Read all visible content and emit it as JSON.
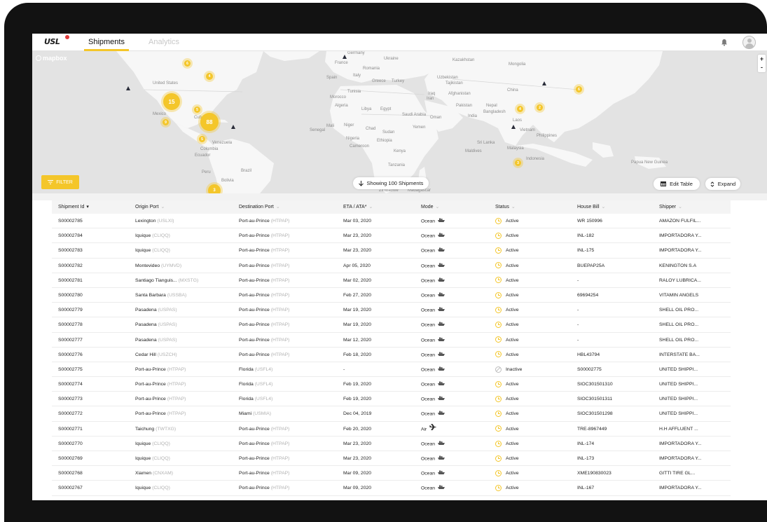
{
  "app": {
    "logo_text": "USL",
    "tabs": [
      {
        "label": "Shipments",
        "active": true
      },
      {
        "label": "Analytics",
        "active": false
      }
    ],
    "accent_color": "#f4c62a"
  },
  "map": {
    "attribution": "mapbox",
    "zoom_in": "+",
    "zoom_out": "-",
    "labels": [
      "Germany",
      "Ukraine",
      "France",
      "Romania",
      "Kazakhstan",
      "Mongolia",
      "Spain",
      "Italy",
      "Greece",
      "Turkey",
      "Uzbekistan",
      "Tajikistan",
      "United States",
      "China",
      "Tunisia",
      "Iraq",
      "Iran",
      "Afghanistan",
      "Morocco",
      "Algeria",
      "Libya",
      "Egypt",
      "Pakistan",
      "Nepal",
      "Saudi Arabia",
      "Bangladesh",
      "Mexico",
      "Cuba",
      "Oman",
      "India",
      "Laos",
      "Mali",
      "Niger",
      "Chad",
      "Sudan",
      "Yemen",
      "Vietnam",
      "Senegal",
      "Philippines",
      "Venezuela",
      "Nigeria",
      "Ethiopia",
      "Sri Lanka",
      "Colombia",
      "Cameroon",
      "Kenya",
      "Maldives",
      "Malaysia",
      "Ecuador",
      "Indonesia",
      "Tanzania",
      "Papua New Guinea",
      "Peru",
      "Brazil",
      "Zimbabwe",
      "Madagascar",
      "Bolivia"
    ],
    "clusters": [
      "15",
      "88",
      "6",
      "4",
      "5",
      "9",
      "5",
      "3",
      "4",
      "2",
      "6",
      "3"
    ],
    "filter_label": "FILTER",
    "showing_label": "Showing 100 Shipments",
    "edit_table_label": "Edit Table",
    "expand_label": "Expand"
  },
  "table": {
    "columns": [
      "Shipment Id",
      "Origin Port",
      "Destination Port",
      "ETA / ATA*",
      "Mode",
      "Status",
      "House Bill",
      "Shipper"
    ],
    "rows": [
      {
        "id": "S00002785",
        "origin": "Lexington",
        "origin_code": "(USLXI)",
        "dest": "Port-au-Prince",
        "dest_code": "(HTPAP)",
        "eta": "Mar 03, 2020",
        "mode": "Ocean",
        "status": "Active",
        "house_bill": "WR 150996",
        "shipper": "AMAZON FULFIL..."
      },
      {
        "id": "S00002784",
        "origin": "Iquique",
        "origin_code": "(CLIQQ)",
        "dest": "Port-au-Prince",
        "dest_code": "(HTPAP)",
        "eta": "Mar 23, 2020",
        "mode": "Ocean",
        "status": "Active",
        "house_bill": "INL-182",
        "shipper": "IMPORTADORA Y..."
      },
      {
        "id": "S00002783",
        "origin": "Iquique",
        "origin_code": "(CLIQQ)",
        "dest": "Port-au-Prince",
        "dest_code": "(HTPAP)",
        "eta": "Mar 23, 2020",
        "mode": "Ocean",
        "status": "Active",
        "house_bill": "INL-175",
        "shipper": "IMPORTADORA Y..."
      },
      {
        "id": "S00002782",
        "origin": "Montevideo",
        "origin_code": "(UYMVD)",
        "dest": "Port-au-Prince",
        "dest_code": "(HTPAP)",
        "eta": "Apr 05, 2020",
        "mode": "Ocean",
        "status": "Active",
        "house_bill": "BUEPAP25A",
        "shipper": "KENINGTON S.A"
      },
      {
        "id": "S00002781",
        "origin": "Santiago Tianguis...",
        "origin_code": "(MXSTG)",
        "dest": "Port-au-Prince",
        "dest_code": "(HTPAP)",
        "eta": "Mar 02, 2020",
        "mode": "Ocean",
        "status": "Active",
        "house_bill": "-",
        "shipper": "RALOY LUBRICA..."
      },
      {
        "id": "S00002780",
        "origin": "Santa Barbara",
        "origin_code": "(USSBA)",
        "dest": "Port-au-Prince",
        "dest_code": "(HTPAP)",
        "eta": "Feb 27, 2020",
        "mode": "Ocean",
        "status": "Active",
        "house_bill": "69694254",
        "shipper": "VITAMIN ANGELS"
      },
      {
        "id": "S00002779",
        "origin": "Pasadena",
        "origin_code": "(USPAS)",
        "dest": "Port-au-Prince",
        "dest_code": "(HTPAP)",
        "eta": "Mar 19, 2020",
        "mode": "Ocean",
        "status": "Active",
        "house_bill": "-",
        "shipper": "SHELL OIL PRO..."
      },
      {
        "id": "S00002778",
        "origin": "Pasadena",
        "origin_code": "(USPAS)",
        "dest": "Port-au-Prince",
        "dest_code": "(HTPAP)",
        "eta": "Mar 19, 2020",
        "mode": "Ocean",
        "status": "Active",
        "house_bill": "-",
        "shipper": "SHELL OIL PRO..."
      },
      {
        "id": "S00002777",
        "origin": "Pasadena",
        "origin_code": "(USPAS)",
        "dest": "Port-au-Prince",
        "dest_code": "(HTPAP)",
        "eta": "Mar 12, 2020",
        "mode": "Ocean",
        "status": "Active",
        "house_bill": "-",
        "shipper": "SHELL OIL PRO..."
      },
      {
        "id": "S00002776",
        "origin": "Cedar Hill",
        "origin_code": "(USZCH)",
        "dest": "Port-au-Prince",
        "dest_code": "(HTPAP)",
        "eta": "Feb 18, 2020",
        "mode": "Ocean",
        "status": "Active",
        "house_bill": "HBL43794",
        "shipper": "INTERSTATE BA..."
      },
      {
        "id": "S00002775",
        "origin": "Port-au-Prince",
        "origin_code": "(HTPAP)",
        "dest": "Florida",
        "dest_code": "(USFL4)",
        "eta": "-",
        "mode": "Ocean",
        "status": "Inactive",
        "house_bill": "S00002775",
        "shipper": "UNITED SHIPPI..."
      },
      {
        "id": "S00002774",
        "origin": "Port-au-Prince",
        "origin_code": "(HTPAP)",
        "dest": "Florida",
        "dest_code": "(USFL4)",
        "eta": "Feb 19, 2020",
        "mode": "Ocean",
        "status": "Active",
        "house_bill": "SIOC301501310",
        "shipper": "UNITED SHIPPI..."
      },
      {
        "id": "S00002773",
        "origin": "Port-au-Prince",
        "origin_code": "(HTPAP)",
        "dest": "Florida",
        "dest_code": "(USFL4)",
        "eta": "Feb 19, 2020",
        "mode": "Ocean",
        "status": "Active",
        "house_bill": "SIOC301501311",
        "shipper": "UNITED SHIPPI..."
      },
      {
        "id": "S00002772",
        "origin": "Port-au-Prince",
        "origin_code": "(HTPAP)",
        "dest": "Miami",
        "dest_code": "(USMIA)",
        "eta": "Dec 04, 2019",
        "mode": "Ocean",
        "status": "Active",
        "house_bill": "SIOC301501298",
        "shipper": "UNITED SHIPPI..."
      },
      {
        "id": "S00002771",
        "origin": "Taichung",
        "origin_code": "(TWTXG)",
        "dest": "Port-au-Prince",
        "dest_code": "(HTPAP)",
        "eta": "Feb 20, 2020",
        "mode": "Air",
        "status": "Active",
        "house_bill": "TRE-8967449",
        "shipper": "H.H AFFLUENT ..."
      },
      {
        "id": "S00002770",
        "origin": "Iquique",
        "origin_code": "(CLIQQ)",
        "dest": "Port-au-Prince",
        "dest_code": "(HTPAP)",
        "eta": "Mar 23, 2020",
        "mode": "Ocean",
        "status": "Active",
        "house_bill": "INL-174",
        "shipper": "IMPORTADORA Y..."
      },
      {
        "id": "S00002769",
        "origin": "Iquique",
        "origin_code": "(CLIQQ)",
        "dest": "Port-au-Prince",
        "dest_code": "(HTPAP)",
        "eta": "Mar 23, 2020",
        "mode": "Ocean",
        "status": "Active",
        "house_bill": "INL-173",
        "shipper": "IMPORTADORA Y..."
      },
      {
        "id": "S00002768",
        "origin": "Xiamen",
        "origin_code": "(CNXAM)",
        "dest": "Port-au-Prince",
        "dest_code": "(HTPAP)",
        "eta": "Mar 09, 2020",
        "mode": "Ocean",
        "status": "Active",
        "house_bill": "XME190830023",
        "shipper": "GITTI TIRE GL..."
      },
      {
        "id": "S00002767",
        "origin": "Iquique",
        "origin_code": "(CLIQQ)",
        "dest": "Port-au-Prince",
        "dest_code": "(HTPAP)",
        "eta": "Mar 09, 2020",
        "mode": "Ocean",
        "status": "Active",
        "house_bill": "INL-167",
        "shipper": "IMPORTADORA Y..."
      }
    ]
  }
}
